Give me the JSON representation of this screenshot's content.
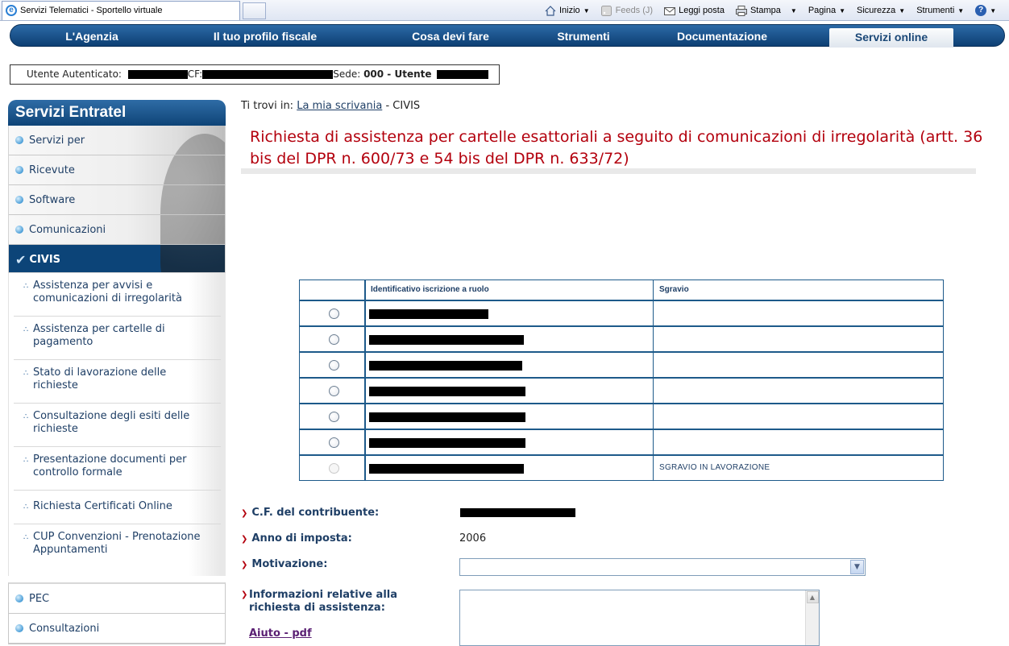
{
  "browser": {
    "tab_title": "Servizi Telematici - Sportello virtuale",
    "commands": [
      {
        "label": "Inizio",
        "icon": "home-icon",
        "dropdown": true,
        "disabled": false
      },
      {
        "label": "Feeds (J)",
        "icon": "feeds-icon",
        "dropdown": false,
        "disabled": true
      },
      {
        "label": "Leggi posta",
        "icon": "mail-icon",
        "dropdown": false,
        "disabled": false
      },
      {
        "label": "Stampa",
        "icon": "print-icon",
        "dropdown": true,
        "disabled": false
      },
      {
        "label": "Pagina",
        "icon": "",
        "dropdown": true,
        "disabled": false
      },
      {
        "label": "Sicurezza",
        "icon": "",
        "dropdown": true,
        "disabled": false
      },
      {
        "label": "Strumenti",
        "icon": "",
        "dropdown": true,
        "disabled": false
      }
    ]
  },
  "nav": {
    "items": [
      "L'Agenzia",
      "Il tuo profilo fiscale",
      "Cosa devi fare",
      "Strumenti",
      "Documentazione",
      "Servizi online"
    ],
    "active": "Servizi online"
  },
  "user": {
    "label_user": "Utente Autenticato:",
    "label_cf": "CF:",
    "label_sede": "Sede:",
    "sede_value": "000 - Utente"
  },
  "sidebar": {
    "title": "Servizi Entratel",
    "items": [
      "Servizi per",
      "Ricevute",
      "Software",
      "Comunicazioni"
    ],
    "active": "CIVIS",
    "sub_items": [
      "Assistenza per avvisi e comunicazioni di irregolarità",
      "Assistenza per cartelle di pagamento",
      "Stato di lavorazione delle richieste",
      "Consultazione degli esiti delle richieste",
      "Presentazione documenti per controllo formale",
      "Richiesta Certificati Online",
      "CUP Convenzioni - Prenotazione Appuntamenti"
    ],
    "bottom_items": [
      "PEC",
      "Consultazioni"
    ]
  },
  "breadcrumb": {
    "prefix": "Ti trovi in:",
    "link": "La mia scrivania",
    "separator": "-",
    "current": "CIVIS"
  },
  "page_title": "Richiesta di assistenza per cartelle esattoriali a seguito di comunicazioni di irregolarità (artt. 36 bis del DPR n. 600/73 e 54 bis del DPR n. 633/72)",
  "table": {
    "headers": [
      "",
      "Identificativo iscrizione a ruolo",
      "Sgravio"
    ],
    "rows": [
      {
        "enabled": true,
        "sgravio": ""
      },
      {
        "enabled": true,
        "sgravio": ""
      },
      {
        "enabled": true,
        "sgravio": ""
      },
      {
        "enabled": true,
        "sgravio": ""
      },
      {
        "enabled": true,
        "sgravio": ""
      },
      {
        "enabled": true,
        "sgravio": ""
      },
      {
        "enabled": false,
        "sgravio": "SGRAVIO IN LAVORAZIONE"
      }
    ]
  },
  "form": {
    "cf_label": "C.F. del contribuente:",
    "anno_label": "Anno di imposta:",
    "anno_value": "2006",
    "motivazione_label": "Motivazione:",
    "motivazione_value": "",
    "info_label": "Informazioni relative alla richiesta di assistenza:",
    "info_value": "",
    "help_link": "Aiuto - pdf"
  }
}
